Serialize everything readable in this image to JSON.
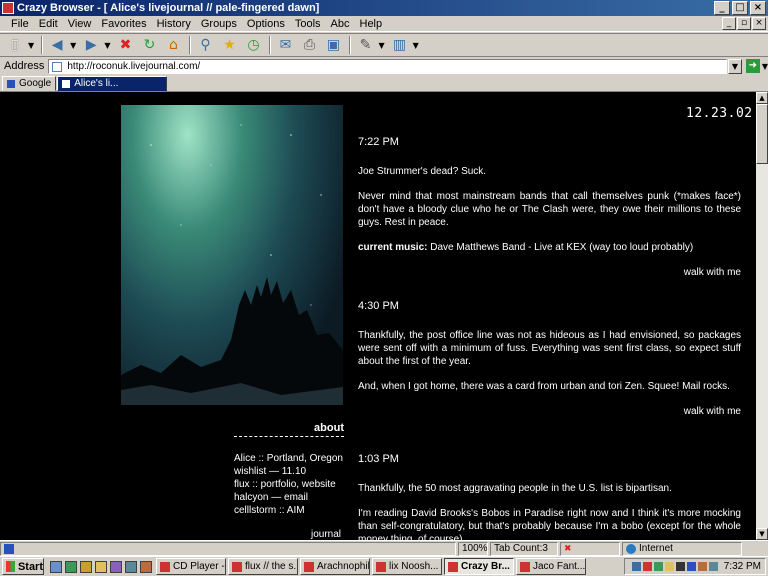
{
  "window": {
    "title": "Crazy Browser - [          Alice's livejournal // pale-fingered dawn]"
  },
  "menu": [
    "File",
    "Edit",
    "View",
    "Favorites",
    "History",
    "Groups",
    "Options",
    "Tools",
    "Abc",
    "Help"
  ],
  "address": {
    "label": "Address",
    "url": "http://roconuk.livejournal.com/"
  },
  "tabs": [
    {
      "label": "Google"
    },
    {
      "label": "Alice's li..."
    }
  ],
  "journal": {
    "date": "12.23.02",
    "about_label": "about",
    "about_lines": [
      "Alice :: Portland, Oregon",
      "wishlist — 11.10",
      "flux :: portfolio, website",
      "halcyon — email",
      "celllstorm :: AIM"
    ],
    "footer_label": "journal",
    "entries": [
      {
        "time": "7:22 PM",
        "paragraphs": [
          "Joe Strummer's dead? Suck.",
          "Never mind that most mainstream bands that call themselves punk (*makes face*) don't have a bloody clue who he or The Clash were, they owe their millions to these guys. Rest in peace."
        ],
        "music_label": "current music:",
        "music": "Dave Matthews Band - Live at KEX (way too loud probably)",
        "walk": "walk with me"
      },
      {
        "time": "4:30 PM",
        "paragraphs": [
          "Thankfully, the post office line was not as hideous as I had envisioned, so packages were sent off with a minimum of fuss. Everything was sent first class, so expect stuff about the first of the year.",
          "And, when I got home, there was a card from urban and tori Zen. Squee! Mail rocks."
        ],
        "walk": "walk with me"
      },
      {
        "time": "1:03 PM",
        "paragraphs": [
          "Thankfully, the 50 most aggravating people in the U.S. list is bipartisan.",
          "I'm reading David Brooks's Bobos in Paradise right now and I think it's more mocking than self-congratulatory, but that's probably because I'm a bobo (except for the whole money thing, of course)."
        ]
      }
    ]
  },
  "status": {
    "zoom": "100%",
    "tab_count": "Tab Count:3",
    "zone": "Internet"
  },
  "taskbar": {
    "start_label": "Start",
    "tasks": [
      {
        "label": "CD Player -..."
      },
      {
        "label": "flux // the s..."
      },
      {
        "label": "Arachnophil..."
      },
      {
        "label": "lix Noosh..."
      },
      {
        "label": "Crazy Br..."
      },
      {
        "label": "Jaco Fant..."
      }
    ],
    "active_task": 4,
    "clock": "7:32 PM"
  }
}
